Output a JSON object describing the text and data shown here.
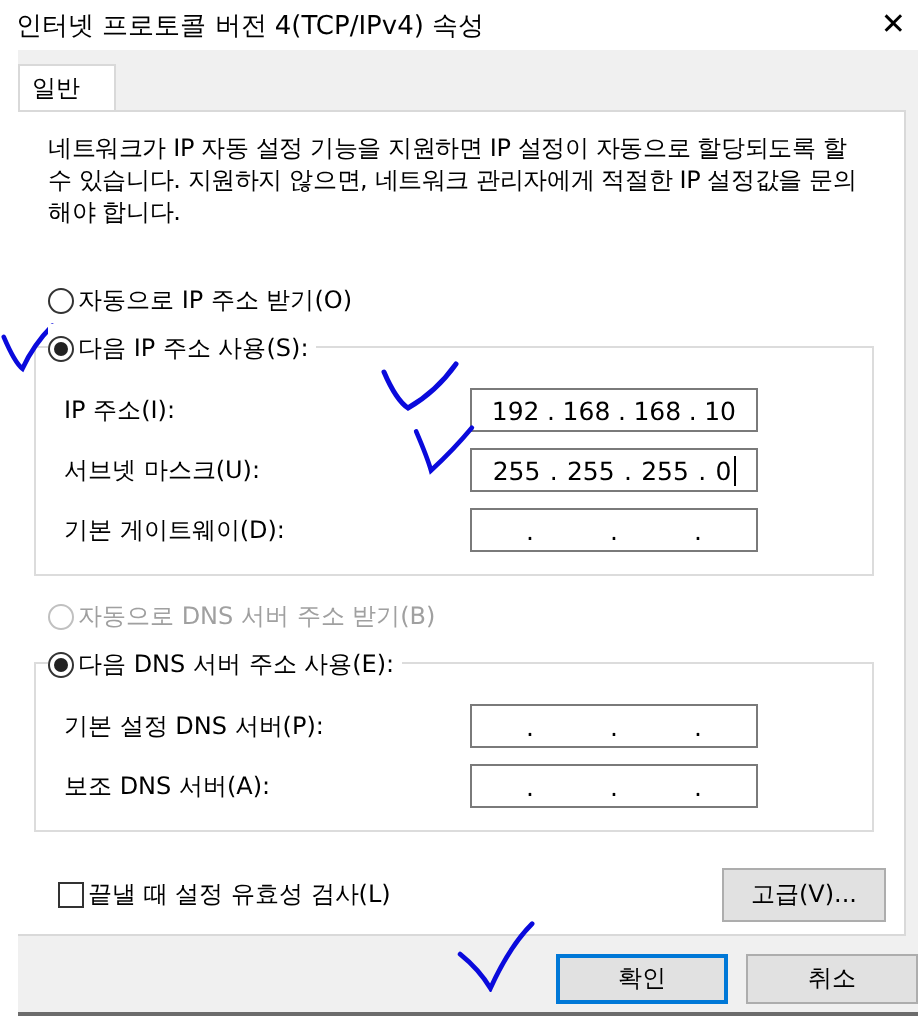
{
  "window": {
    "title": "인터넷 프로토콜 버전 4(TCP/IPv4) 속성",
    "close": "✕"
  },
  "tabs": [
    {
      "label": "일반",
      "selected": true
    }
  ],
  "description": "네트워크가 IP 자동 설정 기능을 지원하면 IP 설정이 자동으로 할당되도록 할 수 있습니다. 지원하지 않으면, 네트워크 관리자에게 적절한 IP 설정값을 문의해야 합니다.",
  "ip_section": {
    "auto_option": {
      "label": "자동으로 IP 주소 받기(O)",
      "selected": false,
      "disabled": false
    },
    "manual_option": {
      "label": "다음 IP 주소 사용(S):",
      "selected": true,
      "disabled": false
    },
    "fields": [
      {
        "label": "IP 주소(I):",
        "parts": [
          "192",
          ".",
          "168",
          ".",
          "168",
          ".",
          "10"
        ],
        "focused": false
      },
      {
        "label": "서브넷 마스크(U):",
        "parts": [
          "255",
          ".",
          "255",
          ".",
          "255",
          ".",
          "0"
        ],
        "focused": true
      },
      {
        "label": "기본 게이트웨이(D):",
        "parts": [
          ".",
          ".",
          "."
        ],
        "focused": false
      }
    ]
  },
  "dns_section": {
    "auto_option": {
      "label": "자동으로 DNS 서버 주소 받기(B)",
      "selected": false,
      "disabled": true
    },
    "manual_option": {
      "label": "다음 DNS 서버 주소 사용(E):",
      "selected": true,
      "disabled": false
    },
    "fields": [
      {
        "label": "기본 설정 DNS 서버(P):",
        "parts": [
          ".",
          ".",
          "."
        ],
        "focused": false
      },
      {
        "label": "보조 DNS 서버(A):",
        "parts": [
          ".",
          ".",
          "."
        ],
        "focused": false
      }
    ]
  },
  "validate_checkbox": {
    "label": "끝낼 때 설정 유효성 검사(L)",
    "checked": false
  },
  "advanced_button": "고급(V)...",
  "buttons": [
    {
      "label": "확인",
      "default": true
    },
    {
      "label": "취소",
      "default": false
    }
  ]
}
